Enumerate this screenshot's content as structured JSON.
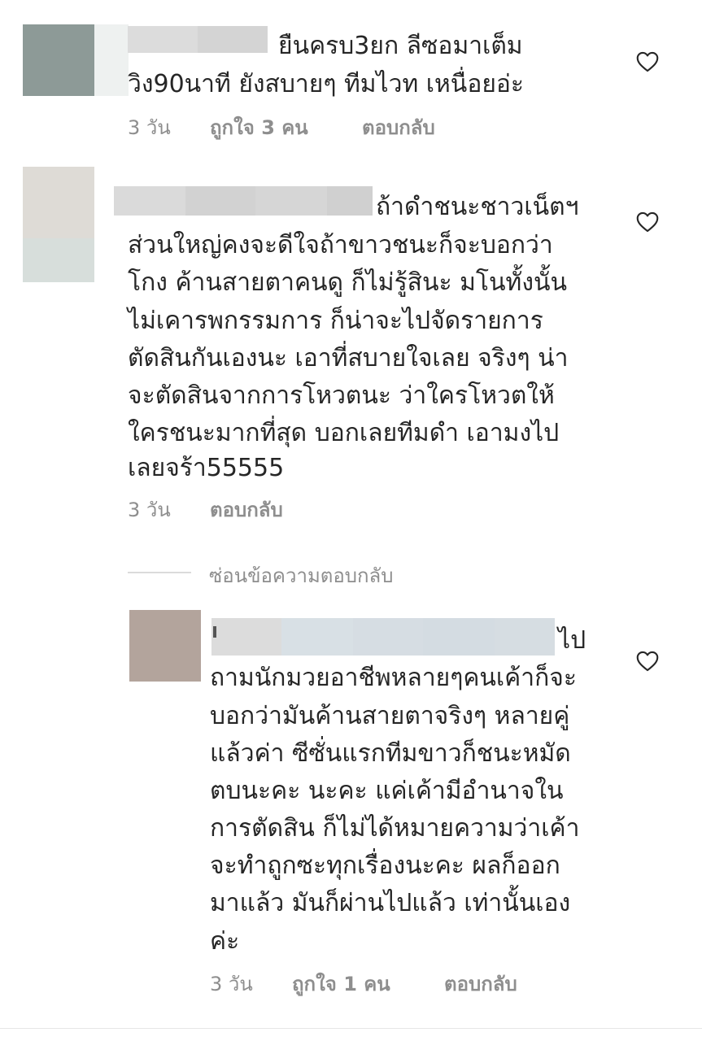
{
  "comments": [
    {
      "lines": [
        "ยืนครบ3ยก ลีซอมาเต็ม",
        "วิง90นาที ยังสบายๆ ทีมไวท  เหนื่อยอ่ะ"
      ],
      "time": "3 วัน",
      "likes": "ถูกใจ 3 คน",
      "reply": "ตอบกลับ"
    },
    {
      "lines": [
        "ถ้าดำชนะชาวเน็ตฯ",
        "ส่วนใหญ่คงจะดีใจถ้าขาวชนะก็จะบอกว่า",
        "โกง ค้านสายตาคนดู  ก็ไม่รู้สินะ  มโนทั้งนั้น",
        "ไม่เคารพกรรมการ ก็น่าจะไปจัดรายการ",
        "ตัดสินกันเองนะ เอาที่สบายใจเลย จริงๆ น่า",
        "จะตัดสินจากการโหวตนะ  ว่าใครโหวตให้",
        "ใครชนะมากที่สุด บอกเลยทีมดำ เอามงไป",
        "เลยจร้า55555"
      ],
      "time": "3 วัน",
      "reply": "ตอบกลับ"
    }
  ],
  "hide_replies": "ซ่อนข้อความตอบกลับ",
  "reply_comment": {
    "lines": [
      "ไป",
      "ถามนักมวยอาชีพหลายๆคนเค้าก็จะ",
      "บอกว่ามันค้านสายตาจริงๆ หลายคู่",
      "แล้วค่า ซีซั่นแรกทีมขาวก็ชนะหมัด",
      "ตบนะคะ นะคะ แค่เค้ามีอำนาจใน",
      "การตัดสิน ก็ไม่ได้หมายความว่าเค้า",
      "จะทำถูกซะทุกเรื่องนะคะ  ผลก็ออก",
      "มาแล้ว มันก็ผ่านไปแล้ว เท่านั้นเอง",
      "ค่ะ"
    ],
    "time": "3 วัน",
    "likes": "ถูกใจ 1 คน",
    "reply": "ตอบกลับ"
  },
  "icons": {
    "like": "heart-outline-icon"
  },
  "colors": {
    "text": "#262626",
    "meta": "#8e8e8e",
    "divider": "#dbdbdb"
  }
}
